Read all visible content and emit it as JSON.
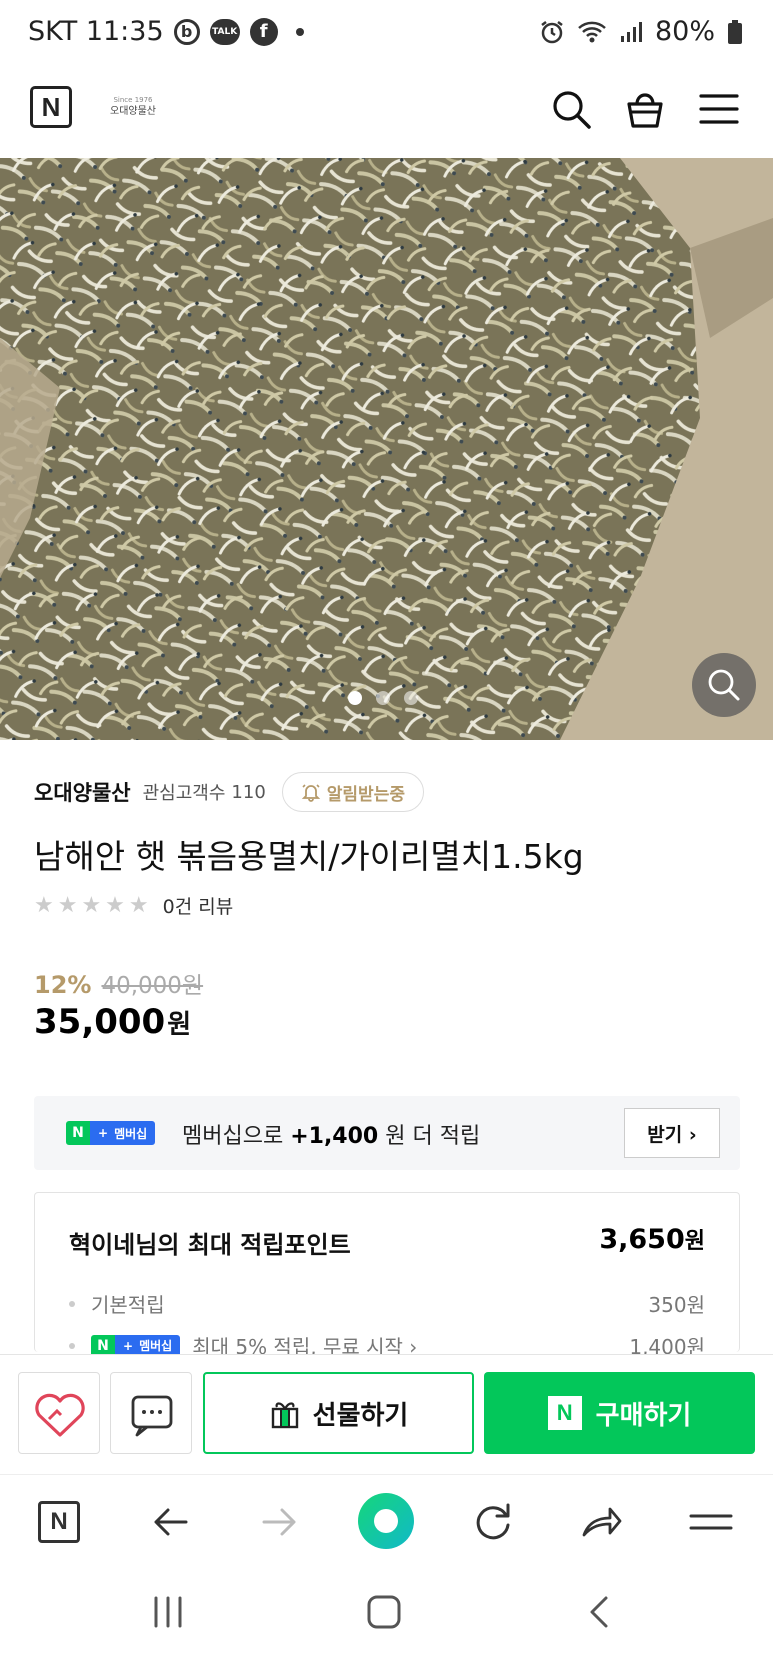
{
  "status_bar": {
    "carrier_time": "SKT 11:35",
    "talk_label": "TALK",
    "battery": "80%"
  },
  "header": {
    "logo_label": "N",
    "shop_logo_text": "오대양물산",
    "shop_logo_since": "Since 1976"
  },
  "hero": {
    "dots": 3,
    "active_dot": 1
  },
  "seller": {
    "name": "오대양물산",
    "follower_label": "관심고객수",
    "follower_count": "110",
    "notify_label": "알림받는중"
  },
  "product": {
    "title": "남해안 햇 볶음용멸치/가이리멸치1.5kg",
    "stars": "★★★★★",
    "review_count": "0건 리뷰",
    "discount_rate": "12%",
    "original_price": "40,000원",
    "price": "35,000",
    "price_unit": "원"
  },
  "membership": {
    "badge_n": "N",
    "badge_plus": "+",
    "badge_label": "멤버십",
    "text_prefix": "멤버십으로",
    "bonus": "+1,400",
    "text_suffix": "원 더 적립",
    "receive_label": "받기 ›"
  },
  "points": {
    "title": "혁이네님의 최대 적립포인트",
    "total": "3,650",
    "total_unit": "원",
    "basic_label": "기본적립",
    "basic_value": "350원",
    "member_label": "최대 5% 적립, 무료 시작 ›",
    "member_value": "1,400원"
  },
  "actions": {
    "gift_label": "선물하기",
    "buy_n": "N",
    "buy_label": "구매하기"
  },
  "browser": {
    "home_label": "N"
  },
  "colors": {
    "naver_green": "#03c75a",
    "accent_gold": "#b59a6a",
    "badge_blue": "#2b6cf0"
  }
}
